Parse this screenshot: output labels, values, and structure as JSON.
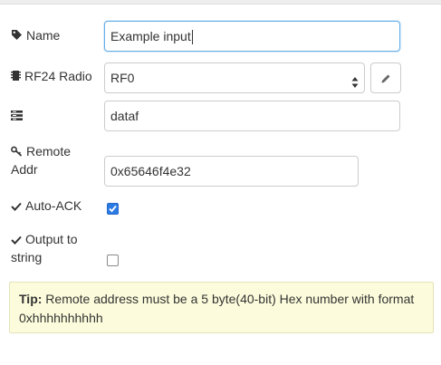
{
  "fields": {
    "name": {
      "label": "Name",
      "value": "Example input"
    },
    "radio": {
      "label": "RF24 Radio",
      "value": "RF0"
    },
    "pipe": {
      "label": "",
      "value": "dataf"
    },
    "remote_addr": {
      "label_line1": "Remote",
      "label_line2": "Addr",
      "value": "0x65646f4e32"
    },
    "auto_ack": {
      "label": "Auto-ACK",
      "checked": true
    },
    "output_string": {
      "label_line1": "Output to",
      "label_line2": "string",
      "checked": false
    }
  },
  "icons": {
    "name": "tag-icon",
    "radio": "chip-icon",
    "pipe": "list-icon",
    "remote_addr": "key-icon",
    "auto_ack": "check-icon",
    "output_string": "check-icon",
    "edit": "pencil-icon",
    "select": "up-down-arrows-icon"
  },
  "tip": {
    "prefix": "Tip:",
    "text": " Remote address must be a 5 byte(40-bit) Hex number with format 0xhhhhhhhhhh"
  },
  "colors": {
    "focus_border": "#66afe9",
    "checkbox_on": "#2c7be5",
    "tip_background": "#fcfcdc"
  }
}
